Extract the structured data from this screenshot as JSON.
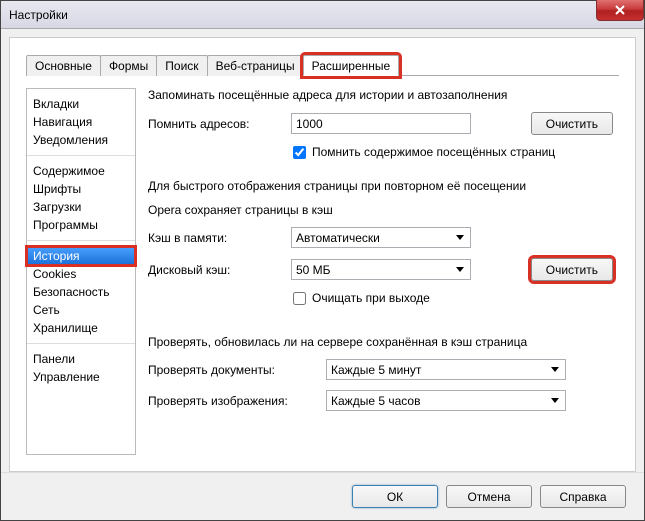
{
  "window": {
    "title": "Настройки"
  },
  "tabs": [
    "Основные",
    "Формы",
    "Поиск",
    "Веб-страницы",
    "Расширенные"
  ],
  "sidebar": {
    "groups": [
      [
        "Вкладки",
        "Навигация",
        "Уведомления"
      ],
      [
        "Содержимое",
        "Шрифты",
        "Загрузки",
        "Программы"
      ],
      [
        "История",
        "Cookies",
        "Безопасность",
        "Сеть",
        "Хранилище"
      ],
      [
        "Панели",
        "Управление"
      ]
    ],
    "selected": "История"
  },
  "main": {
    "remember_text": "Запоминать посещённые адреса для истории и автозаполнения",
    "remember_addresses_label": "Помнить адресов:",
    "remember_addresses_value": "1000",
    "clear_button": "Очистить",
    "remember_content_checkbox": "Помнить содержимое посещённых страниц",
    "cache_desc1": "Для быстрого отображения страницы при повторном её посещении",
    "cache_desc2": "Opera сохраняет страницы в кэш",
    "memory_cache_label": "Кэш в памяти:",
    "memory_cache_value": "Автоматически",
    "disk_cache_label": "Дисковый кэш:",
    "disk_cache_value": "50 МБ",
    "clear_button2": "Очистить",
    "clear_on_exit": "Очищать при выходе",
    "check_server_text": "Проверять, обновилась ли на сервере сохранённая в кэш страница",
    "check_docs_label": "Проверять документы:",
    "check_docs_value": "Каждые 5 минут",
    "check_images_label": "Проверять изображения:",
    "check_images_value": "Каждые 5 часов"
  },
  "footer": {
    "ok": "ОК",
    "cancel": "Отмена",
    "help": "Справка"
  }
}
